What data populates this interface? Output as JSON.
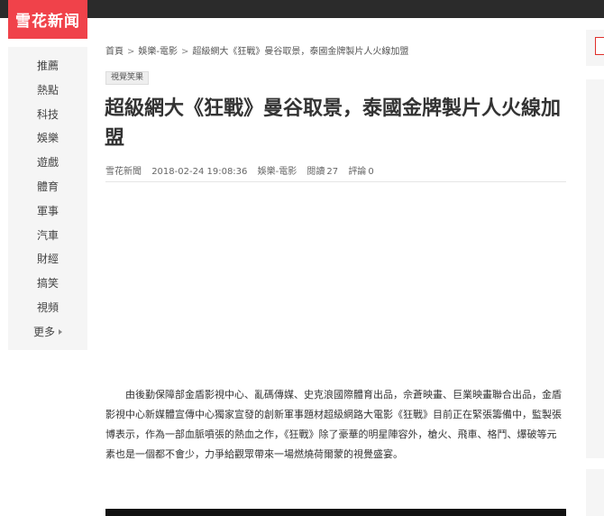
{
  "site": {
    "logo_text": "雪花新闻"
  },
  "sidebar": {
    "items": [
      {
        "label": "推薦"
      },
      {
        "label": "熱點"
      },
      {
        "label": "科技"
      },
      {
        "label": "娛樂"
      },
      {
        "label": "遊戲"
      },
      {
        "label": "體育"
      },
      {
        "label": "軍事"
      },
      {
        "label": "汽車"
      },
      {
        "label": "財經"
      },
      {
        "label": "搞笑"
      },
      {
        "label": "視頻"
      }
    ],
    "more_label": "更多"
  },
  "breadcrumb": {
    "home": "首頁",
    "sep": ">",
    "category": "娛樂-電影",
    "current": "超級網大《狂戰》曼谷取景，泰國金牌製片人火線加盟"
  },
  "article": {
    "tag": "視覺笑果",
    "title": "超級網大《狂戰》曼谷取景，泰國金牌製片人火線加盟",
    "meta": {
      "source": "雪花新聞",
      "datetime": "2018-02-24 19:08:36",
      "category": "娛樂-電影",
      "reads_label": "閱讀",
      "reads": "27",
      "comments_label": "評論",
      "comments": "0"
    },
    "paragraph": "由後勤保障部金盾影視中心、亂碼傳媒、史克浪國際體育出品，佘蒼映畫、巨業映畫聯合出品，金盾影視中心新媒體宣傳中心獨家宣發的創新軍事題材超級網路大電影《狂戰》目前正在緊張籌備中，監製張博表示，作為一部血脈噴張的熱血之作，《狂戰》除了豪華的明星陣容外，槍火、飛車、格鬥、爆破等元素也是一個都不會少，力爭給觀眾帶來一場燃燒荷爾蒙的視覺盛宴。"
  }
}
